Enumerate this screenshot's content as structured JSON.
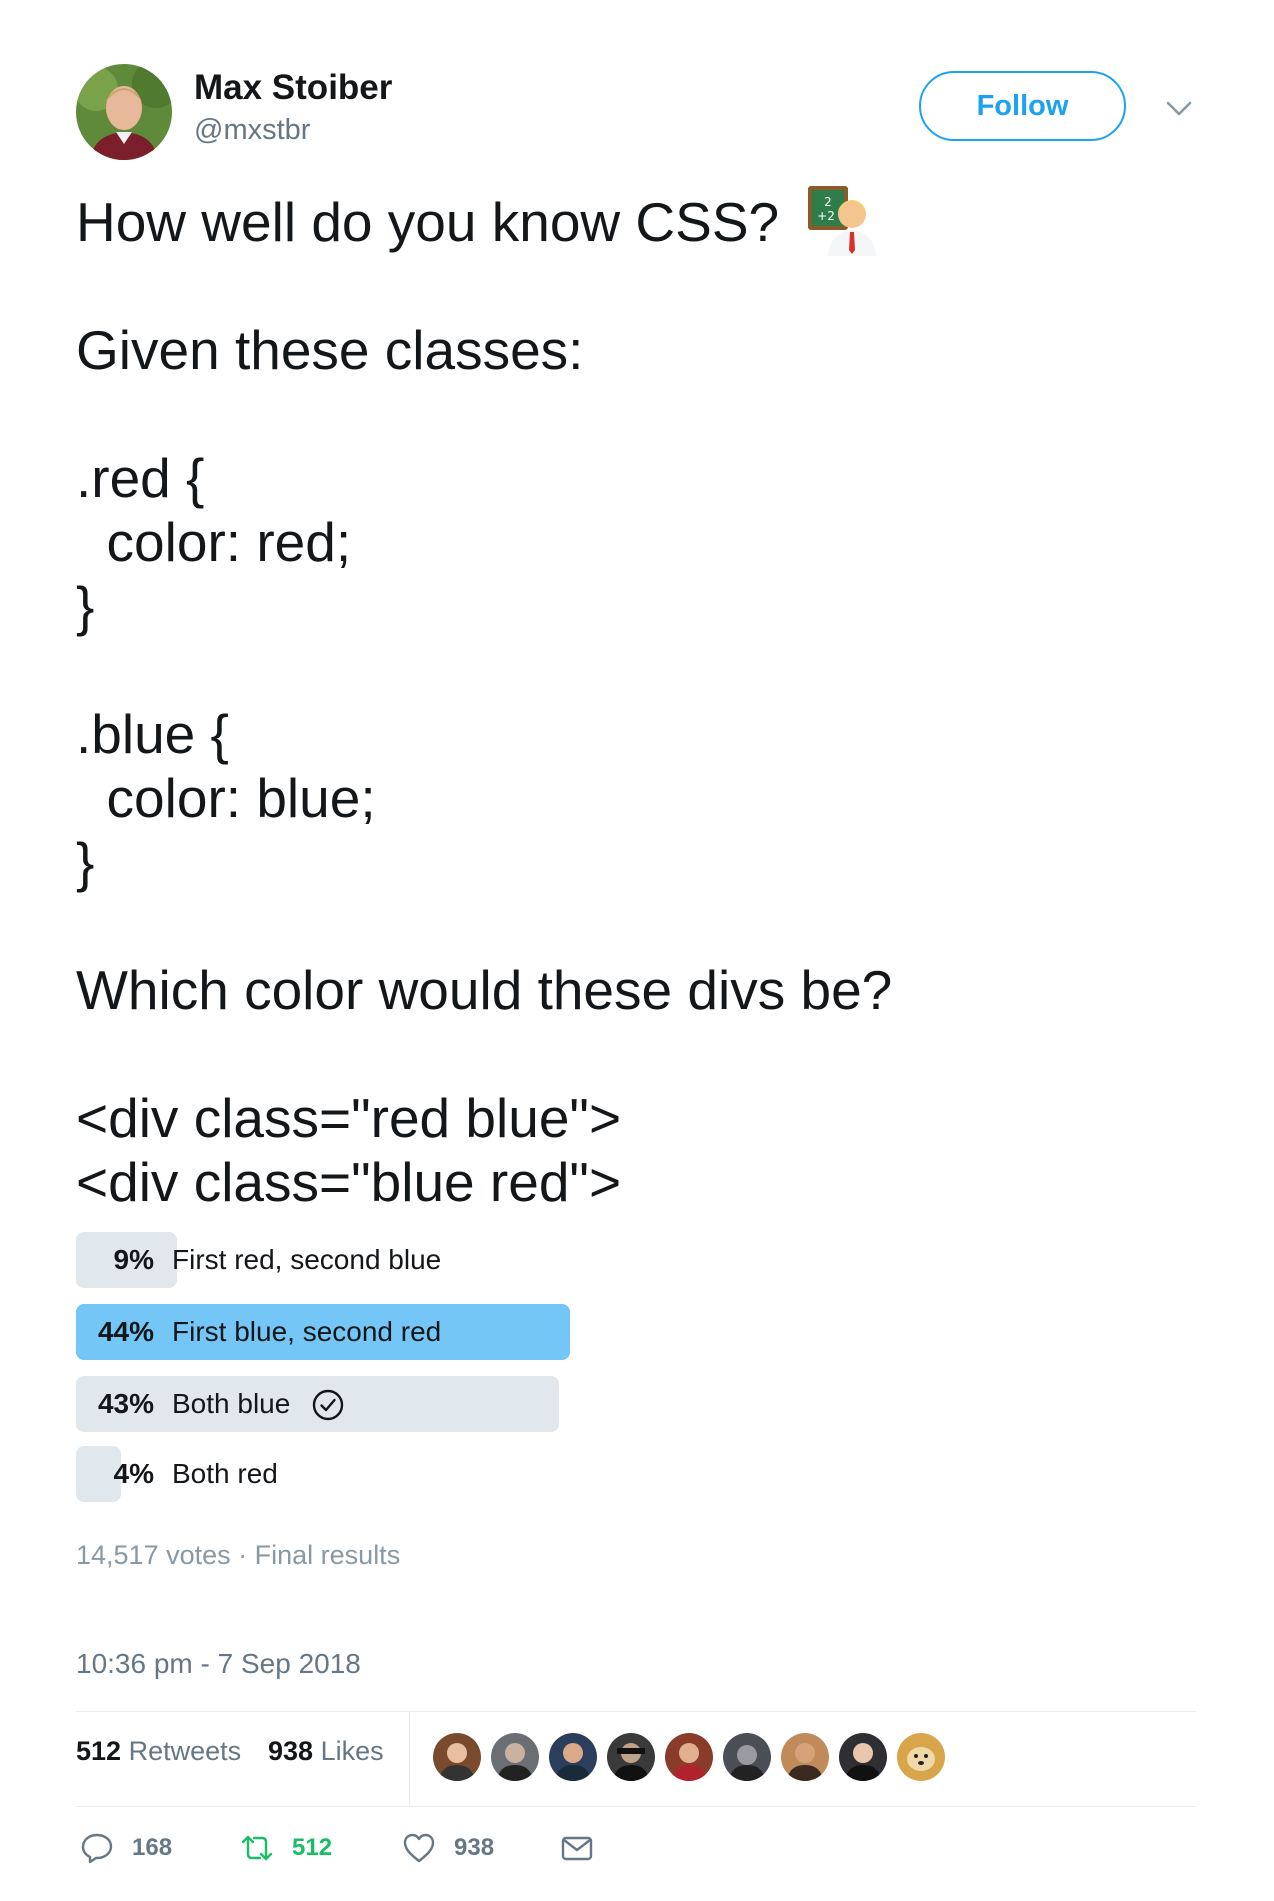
{
  "author": {
    "name": "Max Stoiber",
    "handle": "@mxstbr"
  },
  "follow_label": "Follow",
  "tweet_text": "How well do you know CSS? \n\nGiven these classes:\n\n.red {\n  color: red;\n}\n\n.blue {\n  color: blue;\n}\n\nWhich color would these divs be?\n\n<div class=\"red blue\">\n<div class=\"blue red\">",
  "poll": {
    "options": [
      {
        "percent": "9%",
        "value": 9,
        "label": "First red, second blue",
        "winner": false
      },
      {
        "percent": "44%",
        "value": 44,
        "label": "First blue, second red",
        "winner": true
      },
      {
        "percent": "43%",
        "value": 43,
        "label": "Both blue",
        "winner": false,
        "voted": true
      },
      {
        "percent": "4%",
        "value": 4,
        "label": "Both red",
        "winner": false
      }
    ],
    "votes": "14,517 votes",
    "status": "Final results"
  },
  "timestamp": "10:36 pm - 7 Sep 2018",
  "stats": {
    "retweets_count": "512",
    "retweets_label": "Retweets",
    "likes_count": "938",
    "likes_label": "Likes"
  },
  "liker_colors": [
    "#7a4a2e",
    "#6b6f73",
    "#2b3f5c",
    "#3a3a3a",
    "#8a3b2a",
    "#4b4f55",
    "#c08a5b",
    "#2e2e33",
    "#d9a54a"
  ],
  "actions": {
    "reply_count": "168",
    "retweet_count": "512",
    "like_count": "938"
  },
  "colors": {
    "accent": "#1da1f2",
    "winner_bar": "#73c6f5",
    "bar": "#e1e8ed",
    "retweet_green": "#17bf63"
  },
  "icons": [
    "avatar",
    "chevron-down-icon",
    "teacher-emoji",
    "check-circle-icon",
    "reply-icon",
    "retweet-icon",
    "heart-icon",
    "mail-icon"
  ]
}
